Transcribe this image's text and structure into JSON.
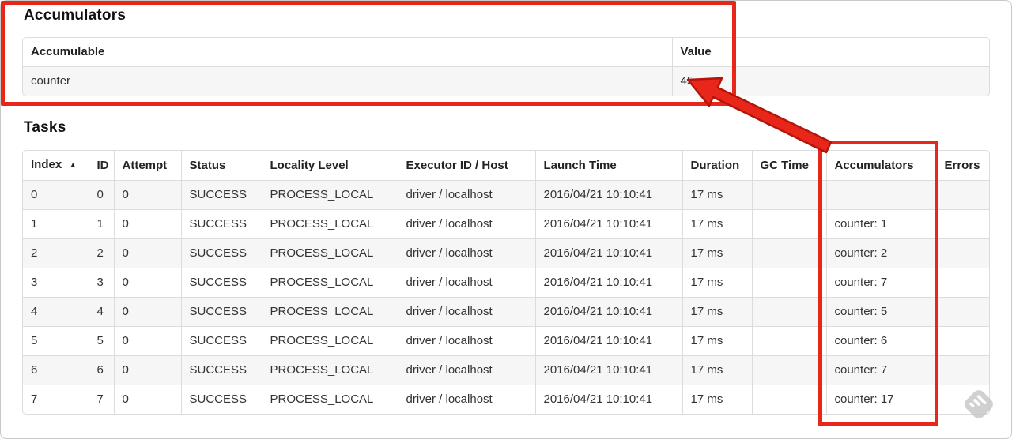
{
  "accumulators_section": {
    "title": "Accumulators",
    "table": {
      "headers": [
        "Accumulable",
        "Value"
      ],
      "rows": [
        {
          "accumulable": "counter",
          "value": "45"
        }
      ]
    }
  },
  "tasks_section": {
    "title": "Tasks",
    "table": {
      "columns": [
        {
          "label": "Index",
          "sort": "▲"
        },
        {
          "label": "ID"
        },
        {
          "label": "Attempt"
        },
        {
          "label": "Status"
        },
        {
          "label": "Locality Level"
        },
        {
          "label": "Executor ID / Host"
        },
        {
          "label": "Launch Time"
        },
        {
          "label": "Duration"
        },
        {
          "label": "GC Time"
        },
        {
          "label": "Accumulators"
        },
        {
          "label": "Errors"
        }
      ],
      "column_keys": [
        "index",
        "id",
        "attempt",
        "status",
        "locality_level",
        "executor_id_host",
        "launch_time",
        "duration",
        "gc_time",
        "accumulators",
        "errors"
      ],
      "rows": [
        {
          "index": "0",
          "id": "0",
          "attempt": "0",
          "status": "SUCCESS",
          "locality_level": "PROCESS_LOCAL",
          "executor_id_host": "driver / localhost",
          "launch_time": "2016/04/21 10:10:41",
          "duration": "17 ms",
          "gc_time": "",
          "accumulators": "",
          "errors": ""
        },
        {
          "index": "1",
          "id": "1",
          "attempt": "0",
          "status": "SUCCESS",
          "locality_level": "PROCESS_LOCAL",
          "executor_id_host": "driver / localhost",
          "launch_time": "2016/04/21 10:10:41",
          "duration": "17 ms",
          "gc_time": "",
          "accumulators": "counter: 1",
          "errors": ""
        },
        {
          "index": "2",
          "id": "2",
          "attempt": "0",
          "status": "SUCCESS",
          "locality_level": "PROCESS_LOCAL",
          "executor_id_host": "driver / localhost",
          "launch_time": "2016/04/21 10:10:41",
          "duration": "17 ms",
          "gc_time": "",
          "accumulators": "counter: 2",
          "errors": ""
        },
        {
          "index": "3",
          "id": "3",
          "attempt": "0",
          "status": "SUCCESS",
          "locality_level": "PROCESS_LOCAL",
          "executor_id_host": "driver / localhost",
          "launch_time": "2016/04/21 10:10:41",
          "duration": "17 ms",
          "gc_time": "",
          "accumulators": "counter: 7",
          "errors": ""
        },
        {
          "index": "4",
          "id": "4",
          "attempt": "0",
          "status": "SUCCESS",
          "locality_level": "PROCESS_LOCAL",
          "executor_id_host": "driver / localhost",
          "launch_time": "2016/04/21 10:10:41",
          "duration": "17 ms",
          "gc_time": "",
          "accumulators": "counter: 5",
          "errors": ""
        },
        {
          "index": "5",
          "id": "5",
          "attempt": "0",
          "status": "SUCCESS",
          "locality_level": "PROCESS_LOCAL",
          "executor_id_host": "driver / localhost",
          "launch_time": "2016/04/21 10:10:41",
          "duration": "17 ms",
          "gc_time": "",
          "accumulators": "counter: 6",
          "errors": ""
        },
        {
          "index": "6",
          "id": "6",
          "attempt": "0",
          "status": "SUCCESS",
          "locality_level": "PROCESS_LOCAL",
          "executor_id_host": "driver / localhost",
          "launch_time": "2016/04/21 10:10:41",
          "duration": "17 ms",
          "gc_time": "",
          "accumulators": "counter: 7",
          "errors": ""
        },
        {
          "index": "7",
          "id": "7",
          "attempt": "0",
          "status": "SUCCESS",
          "locality_level": "PROCESS_LOCAL",
          "executor_id_host": "driver / localhost",
          "launch_time": "2016/04/21 10:10:41",
          "duration": "17 ms",
          "gc_time": "",
          "accumulators": "counter: 17",
          "errors": ""
        }
      ]
    }
  },
  "annotations": {
    "box_color": "#e8261a",
    "arrow_color": "#e8261a",
    "arrow_outline": "#b3150a",
    "watermark_color": "#c8c8c8"
  }
}
